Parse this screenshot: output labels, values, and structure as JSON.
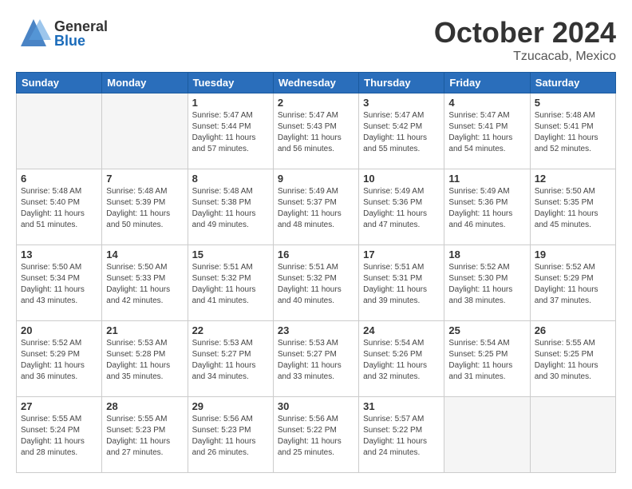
{
  "header": {
    "month_title": "October 2024",
    "subtitle": "Tzucacab, Mexico",
    "logo_general": "General",
    "logo_blue": "Blue"
  },
  "weekdays": [
    "Sunday",
    "Monday",
    "Tuesday",
    "Wednesday",
    "Thursday",
    "Friday",
    "Saturday"
  ],
  "weeks": [
    [
      {
        "day": "",
        "empty": true
      },
      {
        "day": "",
        "empty": true
      },
      {
        "day": "1",
        "sunrise": "Sunrise: 5:47 AM",
        "sunset": "Sunset: 5:44 PM",
        "daylight": "Daylight: 11 hours and 57 minutes."
      },
      {
        "day": "2",
        "sunrise": "Sunrise: 5:47 AM",
        "sunset": "Sunset: 5:43 PM",
        "daylight": "Daylight: 11 hours and 56 minutes."
      },
      {
        "day": "3",
        "sunrise": "Sunrise: 5:47 AM",
        "sunset": "Sunset: 5:42 PM",
        "daylight": "Daylight: 11 hours and 55 minutes."
      },
      {
        "day": "4",
        "sunrise": "Sunrise: 5:47 AM",
        "sunset": "Sunset: 5:41 PM",
        "daylight": "Daylight: 11 hours and 54 minutes."
      },
      {
        "day": "5",
        "sunrise": "Sunrise: 5:48 AM",
        "sunset": "Sunset: 5:41 PM",
        "daylight": "Daylight: 11 hours and 52 minutes."
      }
    ],
    [
      {
        "day": "6",
        "sunrise": "Sunrise: 5:48 AM",
        "sunset": "Sunset: 5:40 PM",
        "daylight": "Daylight: 11 hours and 51 minutes."
      },
      {
        "day": "7",
        "sunrise": "Sunrise: 5:48 AM",
        "sunset": "Sunset: 5:39 PM",
        "daylight": "Daylight: 11 hours and 50 minutes."
      },
      {
        "day": "8",
        "sunrise": "Sunrise: 5:48 AM",
        "sunset": "Sunset: 5:38 PM",
        "daylight": "Daylight: 11 hours and 49 minutes."
      },
      {
        "day": "9",
        "sunrise": "Sunrise: 5:49 AM",
        "sunset": "Sunset: 5:37 PM",
        "daylight": "Daylight: 11 hours and 48 minutes."
      },
      {
        "day": "10",
        "sunrise": "Sunrise: 5:49 AM",
        "sunset": "Sunset: 5:36 PM",
        "daylight": "Daylight: 11 hours and 47 minutes."
      },
      {
        "day": "11",
        "sunrise": "Sunrise: 5:49 AM",
        "sunset": "Sunset: 5:36 PM",
        "daylight": "Daylight: 11 hours and 46 minutes."
      },
      {
        "day": "12",
        "sunrise": "Sunrise: 5:50 AM",
        "sunset": "Sunset: 5:35 PM",
        "daylight": "Daylight: 11 hours and 45 minutes."
      }
    ],
    [
      {
        "day": "13",
        "sunrise": "Sunrise: 5:50 AM",
        "sunset": "Sunset: 5:34 PM",
        "daylight": "Daylight: 11 hours and 43 minutes."
      },
      {
        "day": "14",
        "sunrise": "Sunrise: 5:50 AM",
        "sunset": "Sunset: 5:33 PM",
        "daylight": "Daylight: 11 hours and 42 minutes."
      },
      {
        "day": "15",
        "sunrise": "Sunrise: 5:51 AM",
        "sunset": "Sunset: 5:32 PM",
        "daylight": "Daylight: 11 hours and 41 minutes."
      },
      {
        "day": "16",
        "sunrise": "Sunrise: 5:51 AM",
        "sunset": "Sunset: 5:32 PM",
        "daylight": "Daylight: 11 hours and 40 minutes."
      },
      {
        "day": "17",
        "sunrise": "Sunrise: 5:51 AM",
        "sunset": "Sunset: 5:31 PM",
        "daylight": "Daylight: 11 hours and 39 minutes."
      },
      {
        "day": "18",
        "sunrise": "Sunrise: 5:52 AM",
        "sunset": "Sunset: 5:30 PM",
        "daylight": "Daylight: 11 hours and 38 minutes."
      },
      {
        "day": "19",
        "sunrise": "Sunrise: 5:52 AM",
        "sunset": "Sunset: 5:29 PM",
        "daylight": "Daylight: 11 hours and 37 minutes."
      }
    ],
    [
      {
        "day": "20",
        "sunrise": "Sunrise: 5:52 AM",
        "sunset": "Sunset: 5:29 PM",
        "daylight": "Daylight: 11 hours and 36 minutes."
      },
      {
        "day": "21",
        "sunrise": "Sunrise: 5:53 AM",
        "sunset": "Sunset: 5:28 PM",
        "daylight": "Daylight: 11 hours and 35 minutes."
      },
      {
        "day": "22",
        "sunrise": "Sunrise: 5:53 AM",
        "sunset": "Sunset: 5:27 PM",
        "daylight": "Daylight: 11 hours and 34 minutes."
      },
      {
        "day": "23",
        "sunrise": "Sunrise: 5:53 AM",
        "sunset": "Sunset: 5:27 PM",
        "daylight": "Daylight: 11 hours and 33 minutes."
      },
      {
        "day": "24",
        "sunrise": "Sunrise: 5:54 AM",
        "sunset": "Sunset: 5:26 PM",
        "daylight": "Daylight: 11 hours and 32 minutes."
      },
      {
        "day": "25",
        "sunrise": "Sunrise: 5:54 AM",
        "sunset": "Sunset: 5:25 PM",
        "daylight": "Daylight: 11 hours and 31 minutes."
      },
      {
        "day": "26",
        "sunrise": "Sunrise: 5:55 AM",
        "sunset": "Sunset: 5:25 PM",
        "daylight": "Daylight: 11 hours and 30 minutes."
      }
    ],
    [
      {
        "day": "27",
        "sunrise": "Sunrise: 5:55 AM",
        "sunset": "Sunset: 5:24 PM",
        "daylight": "Daylight: 11 hours and 28 minutes."
      },
      {
        "day": "28",
        "sunrise": "Sunrise: 5:55 AM",
        "sunset": "Sunset: 5:23 PM",
        "daylight": "Daylight: 11 hours and 27 minutes."
      },
      {
        "day": "29",
        "sunrise": "Sunrise: 5:56 AM",
        "sunset": "Sunset: 5:23 PM",
        "daylight": "Daylight: 11 hours and 26 minutes."
      },
      {
        "day": "30",
        "sunrise": "Sunrise: 5:56 AM",
        "sunset": "Sunset: 5:22 PM",
        "daylight": "Daylight: 11 hours and 25 minutes."
      },
      {
        "day": "31",
        "sunrise": "Sunrise: 5:57 AM",
        "sunset": "Sunset: 5:22 PM",
        "daylight": "Daylight: 11 hours and 24 minutes."
      },
      {
        "day": "",
        "empty": true
      },
      {
        "day": "",
        "empty": true
      }
    ]
  ]
}
